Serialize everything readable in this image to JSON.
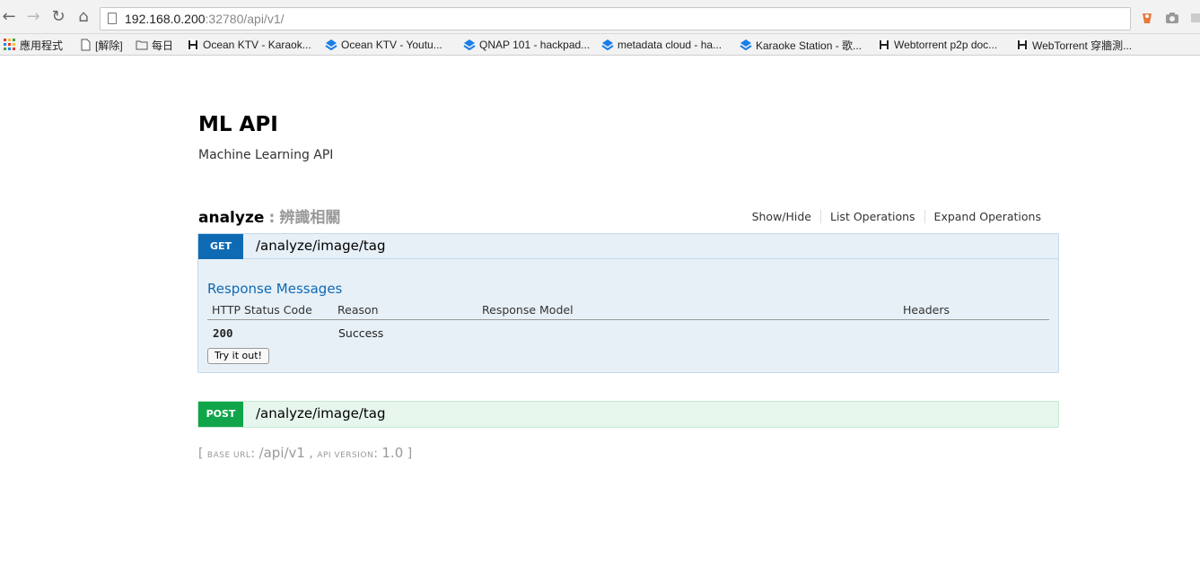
{
  "browser": {
    "url_host": "192.168.0.200",
    "url_rest": ":32780/api/v1/",
    "nav": {
      "back_icon": "back-arrow-icon",
      "forward_icon": "forward-arrow-icon",
      "reload_icon": "reload-icon",
      "home_icon": "home-icon"
    },
    "bookmarks": [
      {
        "label": "應用程式",
        "icon": "apps-grid-icon"
      },
      {
        "label": "[解除]",
        "icon": "page-icon"
      },
      {
        "label": "每日",
        "icon": "folder-icon"
      },
      {
        "label": "Ocean KTV - Karaok...",
        "icon": "hackpad-icon"
      },
      {
        "label": "Ocean KTV - Youtu...",
        "icon": "dropbox-icon"
      },
      {
        "label": "QNAP 101 - hackpad...",
        "icon": "dropbox-icon"
      },
      {
        "label": "metadata cloud - ha...",
        "icon": "dropbox-icon"
      },
      {
        "label": "Karaoke Station - 歌...",
        "icon": "dropbox-icon"
      },
      {
        "label": "Webtorrent p2p doc...",
        "icon": "hackpad-icon"
      },
      {
        "label": "WebTorrent 穿牆測...",
        "icon": "hackpad-icon"
      }
    ]
  },
  "api": {
    "title": "ML API",
    "description": "Machine Learning API"
  },
  "resource": {
    "name": "analyze",
    "separator": ":",
    "description": "辨識相關",
    "links": [
      "Show/Hide",
      "List Operations",
      "Expand Operations"
    ]
  },
  "operations": {
    "get": {
      "method": "GET",
      "path": "/analyze/image/tag",
      "response_title": "Response Messages",
      "columns": [
        "HTTP Status Code",
        "Reason",
        "Response Model",
        "Headers"
      ],
      "rows": [
        {
          "code": "200",
          "reason": "Success",
          "model": "",
          "headers": ""
        }
      ],
      "try_label": "Try it out!"
    },
    "post": {
      "method": "POST",
      "path": "/analyze/image/tag"
    }
  },
  "footer": {
    "open": "[",
    "base_url_label": "BASE URL",
    "base_url": "/api/v1",
    "comma": ",",
    "api_version_label": "API VERSION",
    "api_version": "1.0",
    "close": "]"
  },
  "colors": {
    "get": "#0f6ab4",
    "post": "#10a54a"
  }
}
